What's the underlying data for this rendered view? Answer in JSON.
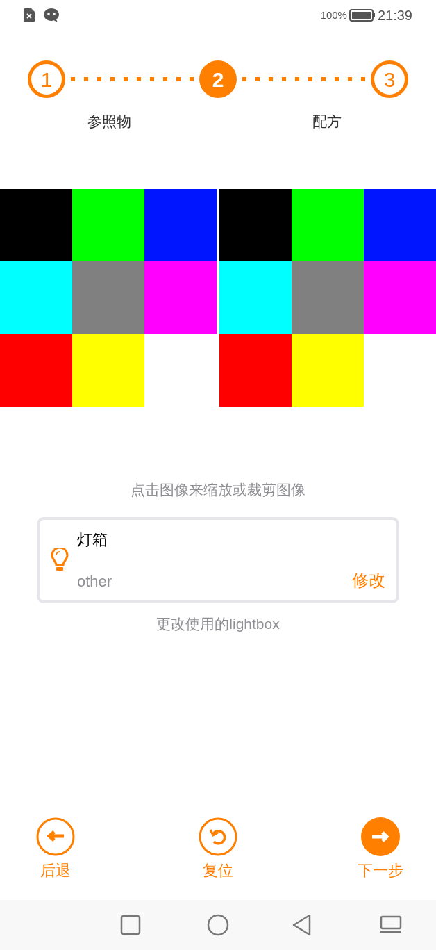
{
  "status_bar": {
    "battery_percent": "100%",
    "time": "21:39"
  },
  "steps": [
    {
      "number": "1",
      "selected": false
    },
    {
      "number": "2",
      "selected": true
    },
    {
      "number": "3",
      "selected": false
    }
  ],
  "step_labels": [
    "参照物",
    "配方"
  ],
  "images": [
    {
      "cells": [
        {
          "color": "#000000"
        },
        {
          "color": "#00ff00"
        },
        {
          "color": "#0015ff"
        },
        {
          "color": "#00ffff"
        },
        {
          "color": "#808080"
        },
        {
          "color": "#ff00ff"
        },
        {
          "color": "#ff0000"
        },
        {
          "color": "#ffff00"
        }
      ]
    },
    {
      "cells": [
        {
          "color": "#000000"
        },
        {
          "color": "#00ff00"
        },
        {
          "color": "#0015ff"
        },
        {
          "color": "#00ffff"
        },
        {
          "color": "#808080"
        },
        {
          "color": "#ff00ff"
        },
        {
          "color": "#ff0000"
        },
        {
          "color": "#ffff00"
        }
      ]
    }
  ],
  "hint": "点击图像来缩放或裁剪图像",
  "lightbox_card": {
    "title": "灯箱",
    "value": "other",
    "action": "修改"
  },
  "caption": "更改使用的lightbox",
  "actions": [
    {
      "kind": "back",
      "label": "后退"
    },
    {
      "kind": "reset",
      "label": "复位"
    },
    {
      "kind": "next",
      "label": "下一步"
    }
  ]
}
